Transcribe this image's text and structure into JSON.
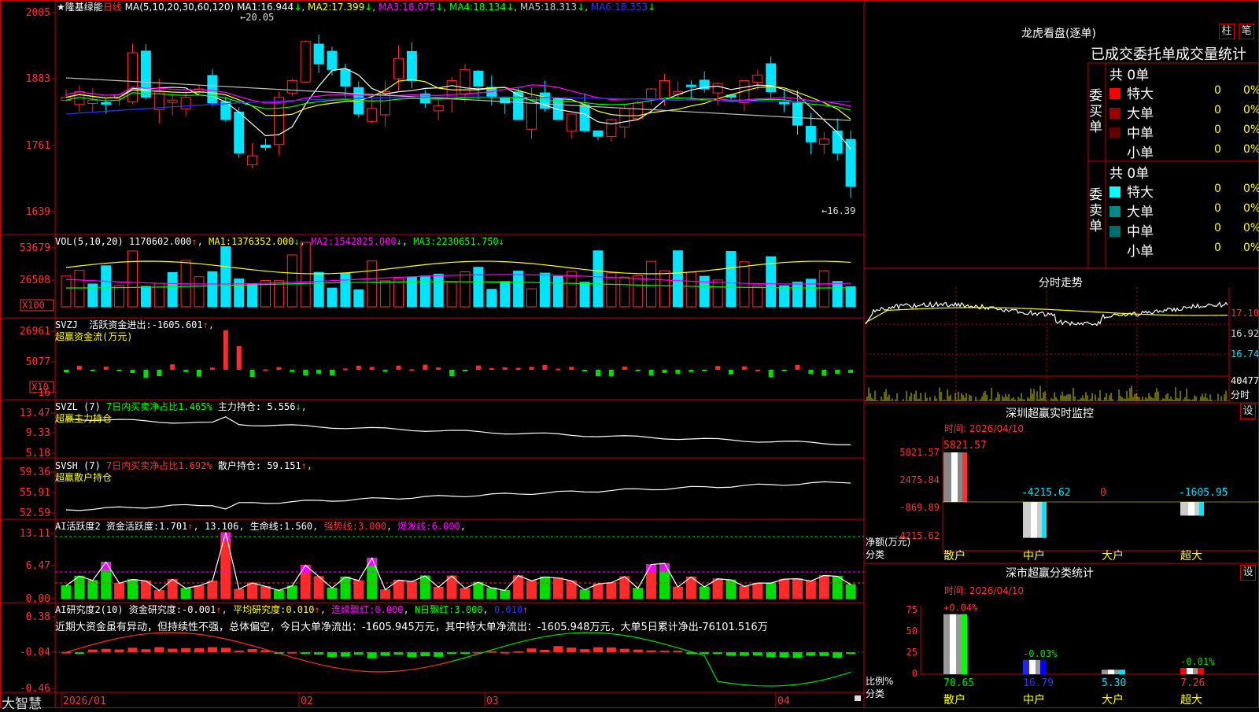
{
  "colors": {
    "up": "#ff2b2b",
    "down": "#00e5ff",
    "frame": "#c00000",
    "ma1": "#ffffff",
    "ma2": "#ffff00",
    "ma3": "#ff00ff",
    "ma4": "#00ff00",
    "ma5": "#c0c0c0",
    "ma6": "#3333ff",
    "green": "#00dd00",
    "yellow": "#ffff00",
    "magenta": "#ff00ff"
  },
  "main": {
    "title_star": "★",
    "stock_name": "隆基绿能",
    "period": "日线",
    "ma_title": "MA(5,10,20,30,60,120)",
    "ma_items": [
      {
        "label": "MA1:",
        "value": "16.944",
        "arrow": "↓"
      },
      {
        "label": "MA2:",
        "value": "17.399",
        "arrow": "↓"
      },
      {
        "label": "MA3:",
        "value": "18.075",
        "arrow": "↓"
      },
      {
        "label": "MA4:",
        "value": "18.134",
        "arrow": "↓"
      },
      {
        "label": "MA5:",
        "value": "18.313",
        "arrow": "↓"
      },
      {
        "label": "MA6:",
        "value": "18.353",
        "arrow": "↓"
      }
    ],
    "high_label": "20.05",
    "low_label": "16.39",
    "yticks": [
      "2005",
      "1883",
      "1761",
      "1639"
    ],
    "yrange": [
      16.25,
      20.15
    ]
  },
  "vol": {
    "title": "VOL(5,10,20)",
    "value": "1170602.000",
    "arrow": "↑",
    "ma": [
      {
        "label": "MA1:",
        "value": "1376352.000",
        "arrow": "↓"
      },
      {
        "label": "MA2:",
        "value": "1542825.000",
        "arrow": "↓"
      },
      {
        "label": "MA3:",
        "value": "2230651.750",
        "arrow": "↓"
      }
    ],
    "yticks": [
      "53679",
      "26508"
    ],
    "unit": "X100"
  },
  "svzj": {
    "title": "SVZJ",
    "text1": "活跃资金进出:",
    "value": "-1605.601",
    "arrow": "↑",
    "text2": "超赢资金流(万元)",
    "yticks": [
      "26961",
      "5077",
      "-16"
    ],
    "unit": "X10"
  },
  "svzl": {
    "title": "SVZL (7)",
    "text1": "7日内买卖净占比1.465%",
    "text2": "主力持仓:",
    "value": "5.556",
    "arrow": "↓",
    "text3": "超赢主力持仓",
    "yticks": [
      "13.47",
      "9.33",
      "5.18"
    ]
  },
  "svsh": {
    "title": "SVSH (7)",
    "text1": "7日内买卖净占比1.692%",
    "text2": "散户持仓:",
    "value": "59.151",
    "arrow": "↑",
    "text3": "超赢散户持仓",
    "yticks": [
      "59.36",
      "55.91",
      "52.59"
    ]
  },
  "ai1": {
    "title": "AI活跃度2",
    "text1": "资金活跃度:",
    "v1": "1.701",
    "arrow": "↑",
    "v2": "13.106",
    "text2": "生命线:",
    "v3": "1.560",
    "text3": "强势线:",
    "v4": "3.000",
    "text4": "爆发线:",
    "v5": "6.000",
    "yticks": [
      "13.11",
      "6.47",
      "0.00"
    ]
  },
  "ai2": {
    "title": "AI研究度2(10)",
    "text1": "资金研究度:",
    "v1": "-0.001",
    "arrow1": "↑",
    "text2": "平均研究度:",
    "v2": "0.010",
    "arrow2": "↑",
    "text3": "连续飘红:",
    "v3": "0.000",
    "text4": "N日飘红:",
    "v4": "3.000",
    "v5": "0.010",
    "arrow5": "↑",
    "note": "近期大资金虽有异动，但持续性不强，总体偏空，今日大单净流出：-1605.945万元，其中特大单净流出：-1605.948万元，大单5日累计净出-76101.516万",
    "yticks": [
      "0.38",
      "-0.04",
      "-0.46"
    ]
  },
  "xaxis": {
    "labels": [
      "2026/01",
      "02",
      "03",
      "04"
    ],
    "brand": "大智慧"
  },
  "lhb": {
    "title": "龙虎看盘(逐单)",
    "btn1": "柱",
    "btn2": "笔",
    "header": "已成交委托单成交量统计",
    "buy": {
      "side": "委买单",
      "total": "共 0单",
      "rows": [
        {
          "name": "特大",
          "v": "0",
          "p": "0%",
          "color": "#ff0000"
        },
        {
          "name": "大单",
          "v": "0",
          "p": "0%",
          "color": "#990000"
        },
        {
          "name": "中单",
          "v": "0",
          "p": "0%",
          "color": "#660000"
        },
        {
          "name": "小单",
          "v": "0",
          "p": "0%",
          "color": ""
        }
      ]
    },
    "sell": {
      "side": "委卖单",
      "total": "共 0单",
      "rows": [
        {
          "name": "特大",
          "v": "0",
          "p": "0%",
          "color": "#00ffff"
        },
        {
          "name": "大单",
          "v": "0",
          "p": "0%",
          "color": "#008b8b"
        },
        {
          "name": "中单",
          "v": "0",
          "p": "0%",
          "color": "#006e6e"
        },
        {
          "name": "小单",
          "v": "0",
          "p": "0%",
          "color": ""
        }
      ]
    }
  },
  "fenshi": {
    "title": "分时走势",
    "yticks": [
      "17.10",
      "16.92",
      "16.74"
    ],
    "vol_label": "40477",
    "vol_unit": "分时"
  },
  "monitor": {
    "title": "深圳超赢实时监控",
    "btn": "设",
    "time": "时间: 2026/04/10",
    "yticks": [
      "5821.57",
      "2475.84",
      "-869.89",
      "-4215.62"
    ],
    "ylabel1": "净额(万元)",
    "ylabel2": "分类",
    "cats": [
      "散户",
      "中户",
      "大户",
      "超大"
    ],
    "values": [
      5821.57,
      -4215.62,
      0,
      -1605.95
    ],
    "value_labels": [
      "5821.57",
      "-4215.62",
      "0",
      "-1605.95"
    ]
  },
  "stats": {
    "title": "深市超赢分类统计",
    "btn": "设",
    "time": "时间: 2026/04/10",
    "yticks": [
      "75",
      "50",
      "25",
      "0"
    ],
    "ylabel1": "比例%",
    "ylabel2": "分类",
    "cats": [
      "散户",
      "中户",
      "大户",
      "超大"
    ],
    "values": [
      70.65,
      16.79,
      5.3,
      7.26
    ],
    "value_labels": [
      "70.65",
      "16.79",
      "5.30",
      "7.26"
    ],
    "change_labels": [
      "+0.04%",
      "-0.03%",
      "",
      "-0.01%"
    ]
  }
}
